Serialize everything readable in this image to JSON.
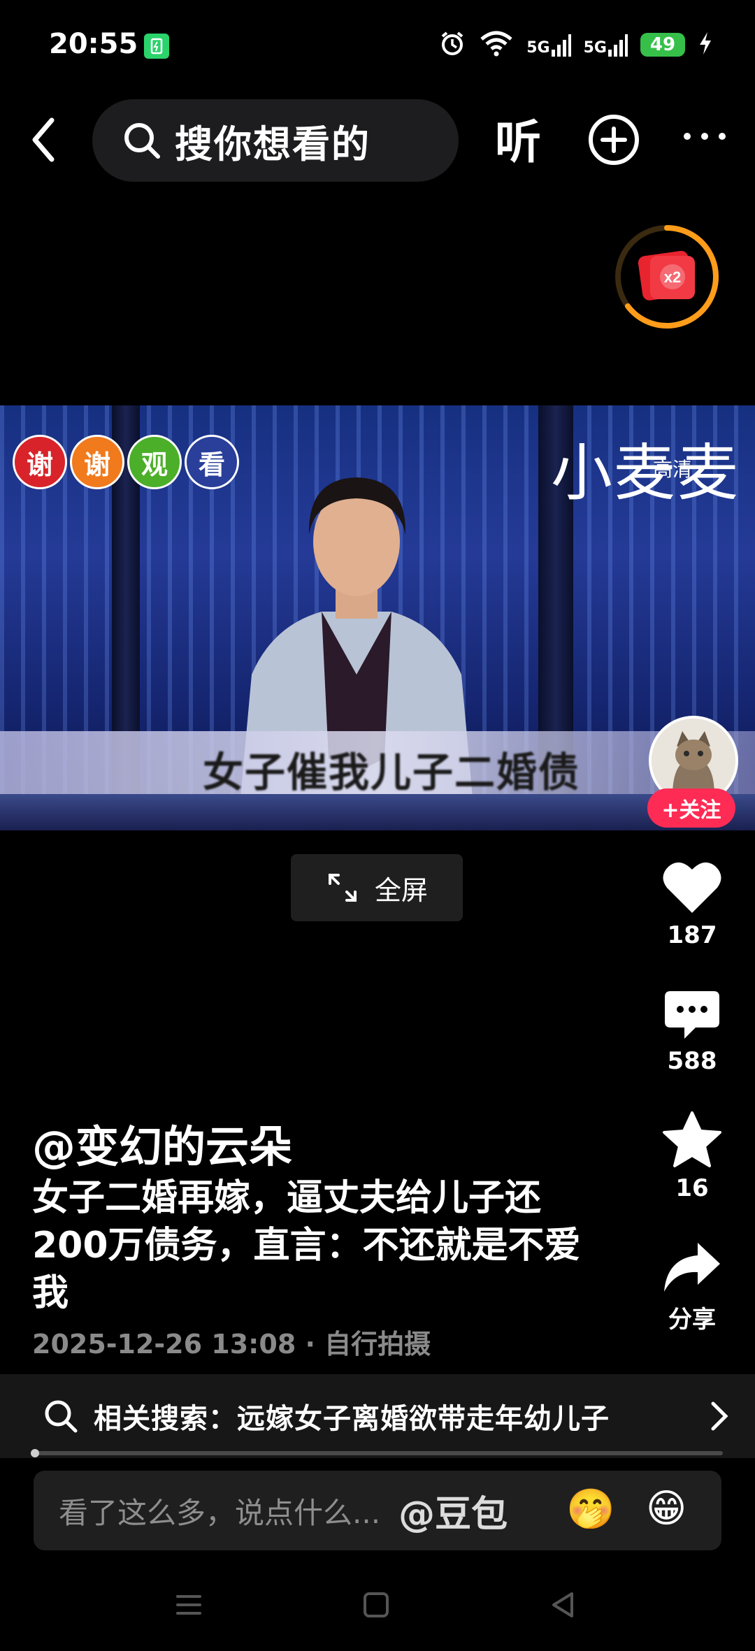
{
  "status_bar": {
    "time": "20:55",
    "signal_1": "5G",
    "signal_2": "5G",
    "battery": "49"
  },
  "top_bar": {
    "search_placeholder": "搜你想看的",
    "listen_label": "听"
  },
  "video": {
    "thanks_bubbles": [
      "谢",
      "谢",
      "观",
      "看"
    ],
    "channel_logo": "小麦麦",
    "channel_logo_sub": "高清",
    "lower_caption": "女子催我儿子二婚债"
  },
  "follow_label": "+关注",
  "fullscreen_label": "全屏",
  "actions": {
    "likes": "187",
    "comments": "588",
    "favorites": "16",
    "share_label": "分享"
  },
  "post": {
    "author": "@变幻的云朵",
    "description": "女子二婚再嫁，逼丈夫给儿子还200万债务，直言：不还就是不爱我",
    "meta": "2025-12-26 13:08 · 自行拍摄"
  },
  "related_search": "相关搜索：远嫁女子离婚欲带走年幼儿子",
  "comment": {
    "placeholder": "看了这么多，说点什么...",
    "mention": "@豆包",
    "emoji_1": "🤭",
    "emoji_2": "😁"
  },
  "colors": {
    "follow_red": "#fe2c55",
    "battery_green": "#36c04a",
    "redpacket_ring": "#ff9c1a"
  }
}
